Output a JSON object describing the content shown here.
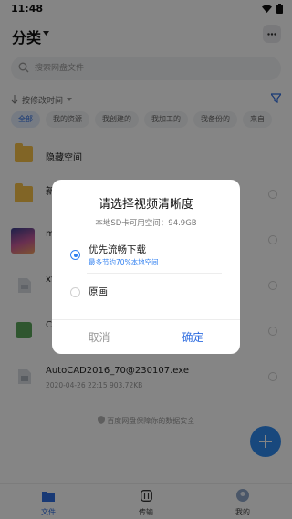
{
  "status_bar": {
    "time": "11:48"
  },
  "header": {
    "title": "分类"
  },
  "search": {
    "placeholder": "搜索网盘文件"
  },
  "sort": {
    "label": "按修改时间"
  },
  "filter_chips": [
    "全部",
    "我的资源",
    "我创建的",
    "我加工的",
    "我备份的",
    "来自"
  ],
  "files": [
    {
      "name": "隐藏空间",
      "meta": "",
      "icon": "folder-icon"
    },
    {
      "name": "新",
      "meta": "",
      "icon": "folder-icon"
    },
    {
      "name": "m",
      "meta": "",
      "icon": "image-thumbnail"
    },
    {
      "name": "xf",
      "meta": "",
      "icon": "file-icon"
    },
    {
      "name": "CA",
      "meta": "",
      "icon": "app-icon"
    },
    {
      "name": "AutoCAD2016_70@230107.exe",
      "meta": "2020-04-26  22:15   903.72KB",
      "icon": "exe-icon"
    }
  ],
  "safe_note": "百度网盘保障你的数据安全",
  "bottom_nav": [
    {
      "label": "文件",
      "icon": "files-icon"
    },
    {
      "label": "传输",
      "icon": "transfer-icon"
    },
    {
      "label": "我的",
      "icon": "avatar-icon"
    }
  ],
  "dialog": {
    "title": "请选择视频清晰度",
    "subtitle": "本地SD卡可用空间：94.9GB",
    "options": [
      {
        "label": "优先流畅下载",
        "hint": "最多节约70%本地空间",
        "selected": true
      },
      {
        "label": "原画",
        "hint": "",
        "selected": false
      }
    ],
    "cancel_label": "取消",
    "confirm_label": "确定"
  },
  "colors": {
    "accent": "#2f6de0",
    "fab": "#2f8bf0",
    "folder": "#f7c14a"
  }
}
